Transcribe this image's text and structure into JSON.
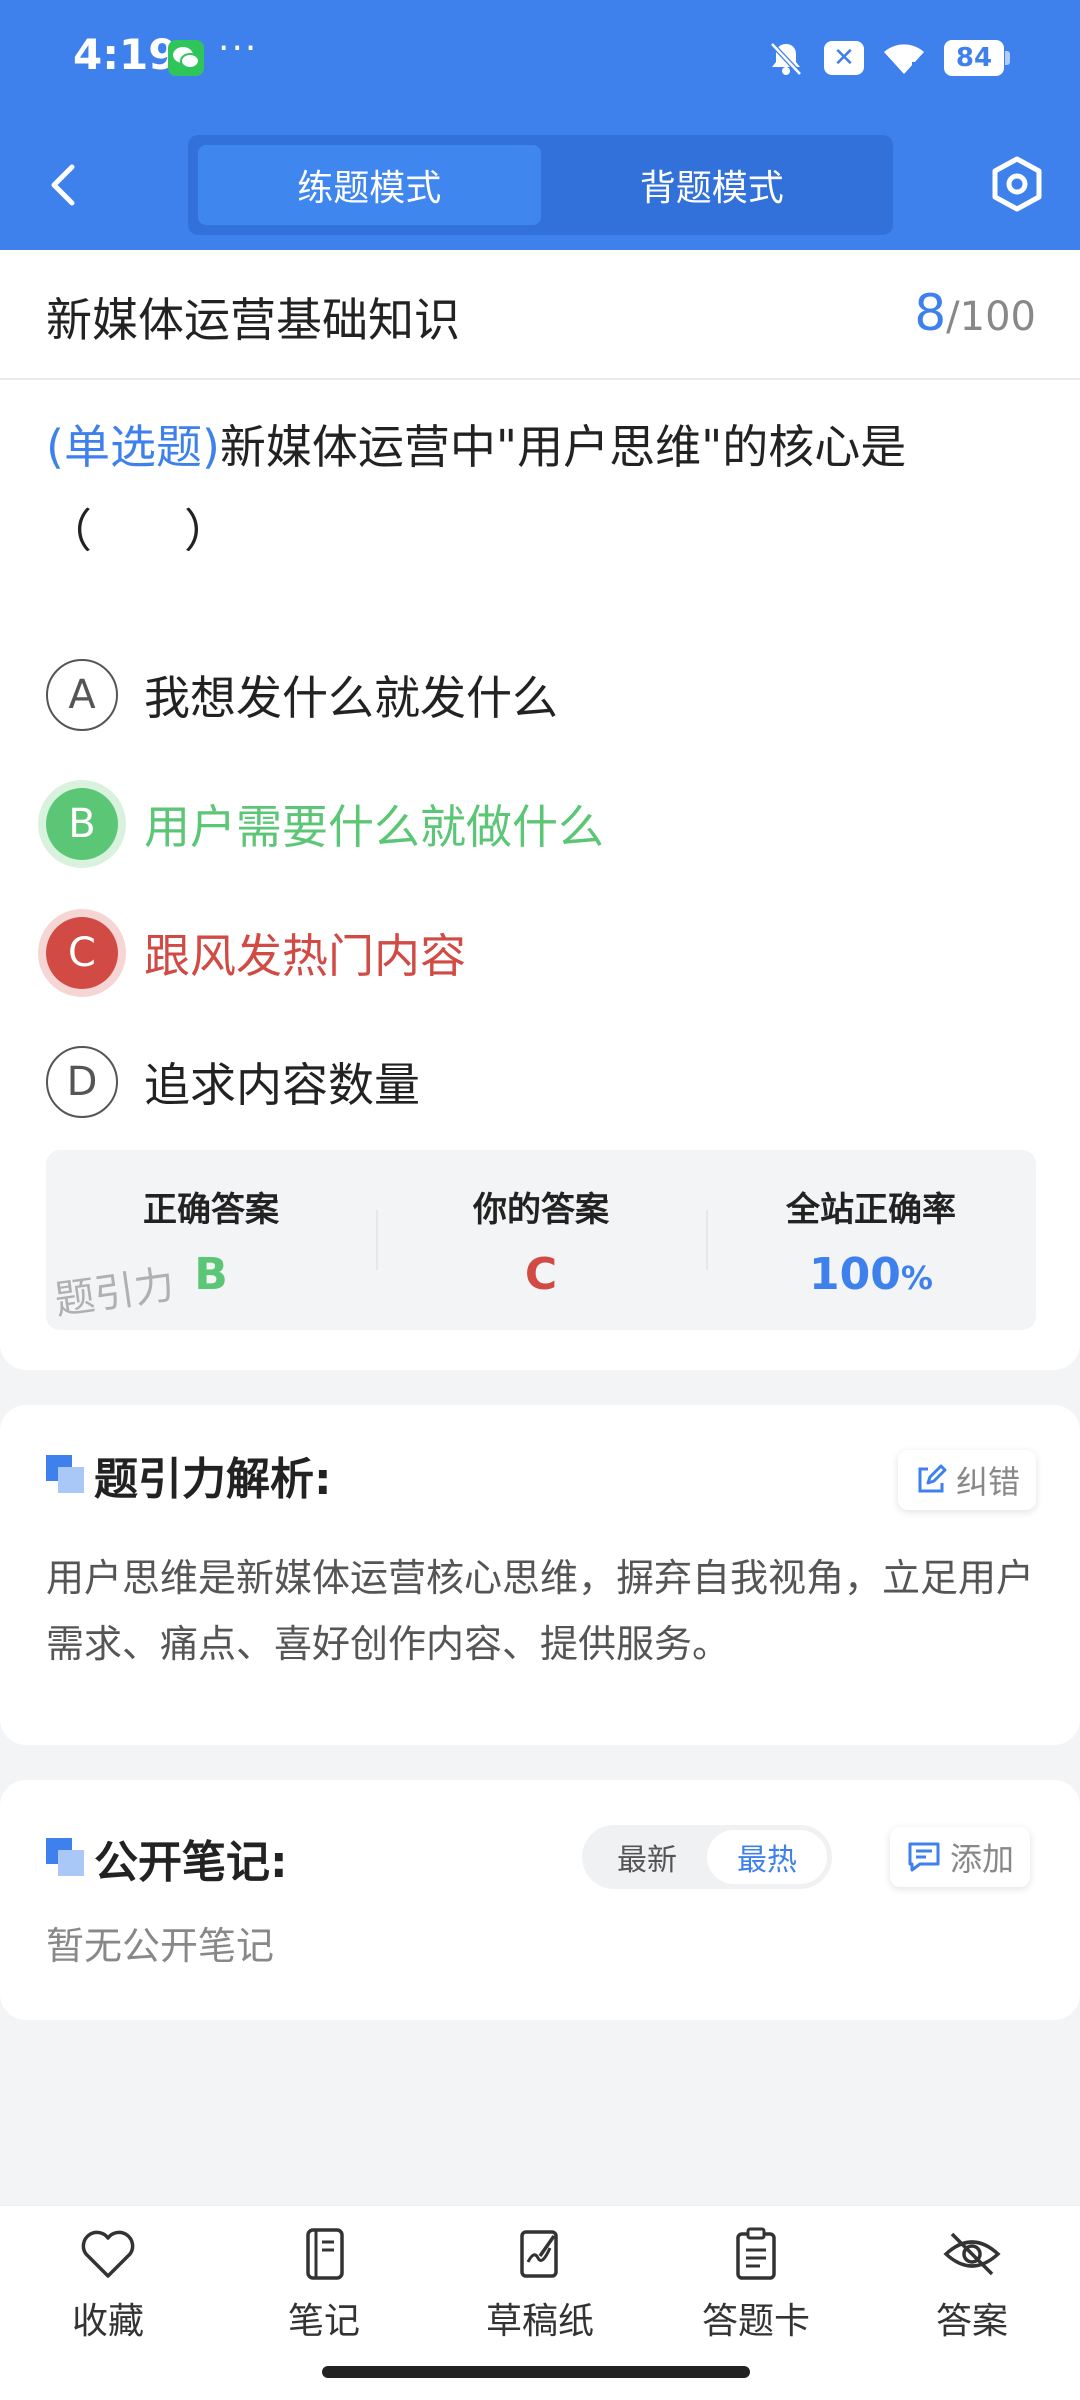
{
  "status_bar": {
    "time": "4:19",
    "dots": "···",
    "battery": "84"
  },
  "header": {
    "modes": [
      "练题模式",
      "背题模式"
    ],
    "active_mode_index": 0
  },
  "subject": {
    "title": "新媒体运营基础知识",
    "current": "8",
    "total": "/100"
  },
  "question": {
    "type": "(单选题)",
    "text": "新媒体运营中\"用户思维\"的核心是",
    "blank": "（　　）"
  },
  "options": [
    {
      "letter": "A",
      "text": "我想发什么就发什么",
      "state": "normal"
    },
    {
      "letter": "B",
      "text": "用户需要什么就做什么",
      "state": "correct"
    },
    {
      "letter": "C",
      "text": "跟风发热门内容",
      "state": "wrong"
    },
    {
      "letter": "D",
      "text": "追求内容数量",
      "state": "normal"
    }
  ],
  "answer_summary": {
    "correct_label": "正确答案",
    "correct_value": "B",
    "yours_label": "你的答案",
    "yours_value": "C",
    "rate_label": "全站正确率",
    "rate_value": "100",
    "rate_unit": "%",
    "watermark": "题引力"
  },
  "analysis": {
    "title": "题引力解析:",
    "report_label": "纠错",
    "text": "用户思维是新媒体运营核心思维，摒弃自我视角，立足用户需求、痛点、喜好创作内容、提供服务。"
  },
  "notes": {
    "title": "公开笔记:",
    "sort_options": [
      "最新",
      "最热"
    ],
    "active_sort_index": 1,
    "add_label": "添加",
    "empty_text": "暂无公开笔记"
  },
  "bottom_nav": [
    {
      "label": "收藏",
      "icon": "heart-icon"
    },
    {
      "label": "笔记",
      "icon": "notebook-icon"
    },
    {
      "label": "草稿纸",
      "icon": "draft-paper-icon"
    },
    {
      "label": "答题卡",
      "icon": "answer-card-icon"
    },
    {
      "label": "答案",
      "icon": "eye-off-icon"
    }
  ],
  "colors": {
    "brand_blue": "#3f81ec",
    "correct_green": "#5bc675",
    "wrong_red": "#d14a44"
  }
}
